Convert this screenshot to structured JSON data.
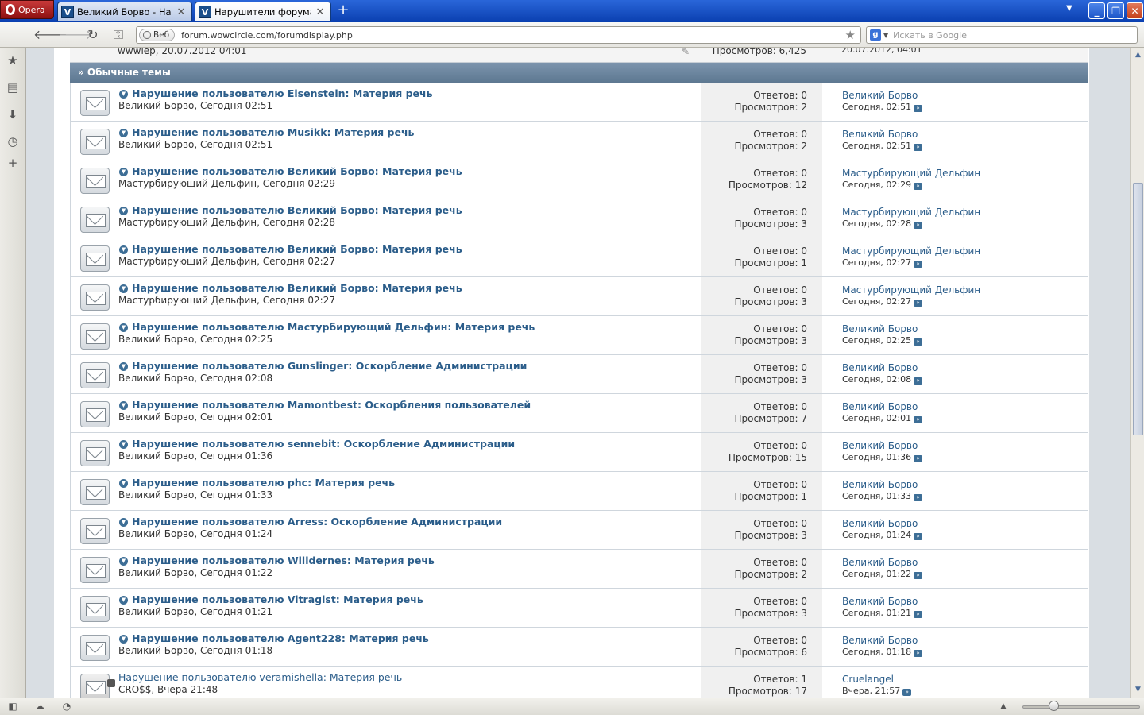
{
  "browser": {
    "menu_label": "Opera",
    "tabs": [
      {
        "title": "Великий Борво - Наруш…",
        "active": false,
        "favicon": "V"
      },
      {
        "title": "Нарушители форума - …",
        "active": true,
        "favicon": "V"
      }
    ],
    "address": {
      "badge": "Веб",
      "url": "forum.wowcircle.com/forumdisplay.php"
    },
    "search_placeholder": "Искать в Google",
    "search_engine_letter": "g"
  },
  "sticky_partial": {
    "meta": "wwwlep, 20.07.2012 04:01",
    "views": "Просмотров: 6,425",
    "last_date": "20.07.2012, 04:01"
  },
  "section_title": "» Обычные темы",
  "threads": [
    {
      "title": "Нарушение пользователю Eisenstein: Материя речь",
      "author_line": "Великий Борво, Сегодня 02:51",
      "replies": "Ответов: 0",
      "views": "Просмотров: 2",
      "last_user": "Великий Борво",
      "last_date": "Сегодня, 02:51",
      "unread": true
    },
    {
      "title": "Нарушение пользователю Musikk: Материя речь",
      "author_line": "Великий Борво, Сегодня 02:51",
      "replies": "Ответов: 0",
      "views": "Просмотров: 2",
      "last_user": "Великий Борво",
      "last_date": "Сегодня, 02:51",
      "unread": true
    },
    {
      "title": "Нарушение пользователю Великий Борво: Материя речь",
      "author_line": "Мастурбирующий Дельфин, Сегодня 02:29",
      "replies": "Ответов: 0",
      "views": "Просмотров: 12",
      "last_user": "Мастурбирующий Дельфин",
      "last_date": "Сегодня, 02:29",
      "unread": true
    },
    {
      "title": "Нарушение пользователю Великий Борво: Материя речь",
      "author_line": "Мастурбирующий Дельфин, Сегодня 02:28",
      "replies": "Ответов: 0",
      "views": "Просмотров: 3",
      "last_user": "Мастурбирующий Дельфин",
      "last_date": "Сегодня, 02:28",
      "unread": true
    },
    {
      "title": "Нарушение пользователю Великий Борво: Материя речь",
      "author_line": "Мастурбирующий Дельфин, Сегодня 02:27",
      "replies": "Ответов: 0",
      "views": "Просмотров: 1",
      "last_user": "Мастурбирующий Дельфин",
      "last_date": "Сегодня, 02:27",
      "unread": true
    },
    {
      "title": "Нарушение пользователю Великий Борво: Материя речь",
      "author_line": "Мастурбирующий Дельфин, Сегодня 02:27",
      "replies": "Ответов: 0",
      "views": "Просмотров: 3",
      "last_user": "Мастурбирующий Дельфин",
      "last_date": "Сегодня, 02:27",
      "unread": true
    },
    {
      "title": "Нарушение пользователю Мастурбирующий Дельфин: Материя речь",
      "author_line": "Великий Борво, Сегодня 02:25",
      "replies": "Ответов: 0",
      "views": "Просмотров: 3",
      "last_user": "Великий Борво",
      "last_date": "Сегодня, 02:25",
      "unread": true
    },
    {
      "title": "Нарушение пользователю Gunslinger: Оскорбление Администрации",
      "author_line": "Великий Борво, Сегодня 02:08",
      "replies": "Ответов: 0",
      "views": "Просмотров: 3",
      "last_user": "Великий Борво",
      "last_date": "Сегодня, 02:08",
      "unread": true
    },
    {
      "title": "Нарушение пользователю Mamontbest: Оскорбления пользователей",
      "author_line": "Великий Борво, Сегодня 02:01",
      "replies": "Ответов: 0",
      "views": "Просмотров: 7",
      "last_user": "Великий Борво",
      "last_date": "Сегодня, 02:01",
      "unread": true
    },
    {
      "title": "Нарушение пользователю sennebit: Оскорбление Администрации",
      "author_line": "Великий Борво, Сегодня 01:36",
      "replies": "Ответов: 0",
      "views": "Просмотров: 15",
      "last_user": "Великий Борво",
      "last_date": "Сегодня, 01:36",
      "unread": true
    },
    {
      "title": "Нарушение пользователю phc: Материя речь",
      "author_line": "Великий Борво, Сегодня 01:33",
      "replies": "Ответов: 0",
      "views": "Просмотров: 1",
      "last_user": "Великий Борво",
      "last_date": "Сегодня, 01:33",
      "unread": true
    },
    {
      "title": "Нарушение пользователю Arress: Оскорбление Администрации",
      "author_line": "Великий Борво, Сегодня 01:24",
      "replies": "Ответов: 0",
      "views": "Просмотров: 3",
      "last_user": "Великий Борво",
      "last_date": "Сегодня, 01:24",
      "unread": true
    },
    {
      "title": "Нарушение пользователю Willdernes: Материя речь",
      "author_line": "Великий Борво, Сегодня 01:22",
      "replies": "Ответов: 0",
      "views": "Просмотров: 2",
      "last_user": "Великий Борво",
      "last_date": "Сегодня, 01:22",
      "unread": true
    },
    {
      "title": "Нарушение пользователю Vitragist: Материя речь",
      "author_line": "Великий Борво, Сегодня 01:21",
      "replies": "Ответов: 0",
      "views": "Просмотров: 3",
      "last_user": "Великий Борво",
      "last_date": "Сегодня, 01:21",
      "unread": true
    },
    {
      "title": "Нарушение пользователю Agent228: Материя речь",
      "author_line": "Великий Борво, Сегодня 01:18",
      "replies": "Ответов: 0",
      "views": "Просмотров: 6",
      "last_user": "Великий Борво",
      "last_date": "Сегодня, 01:18",
      "unread": true
    },
    {
      "title": "Нарушение пользователю veramishella: Материя речь",
      "author_line": "CRO$$, Вчера 21:48",
      "replies": "Ответов: 1",
      "views": "Просмотров: 17",
      "last_user": "Cruelangel",
      "last_date": "Вчера, 21:57",
      "unread": false
    }
  ],
  "icons": {
    "sidebar": [
      "bookmarks-star-icon",
      "notes-icon",
      "downloads-icon",
      "history-clock-icon",
      "add-panel-icon"
    ],
    "status": [
      "panel-toggle-icon",
      "opera-unite-cloud-icon",
      "turbo-gauge-icon"
    ]
  },
  "colors": {
    "link": "#2b5d8a",
    "section_header": "#6a849e",
    "stats_bg": "#f0f0f0",
    "tabbar": "#1a52c4"
  }
}
